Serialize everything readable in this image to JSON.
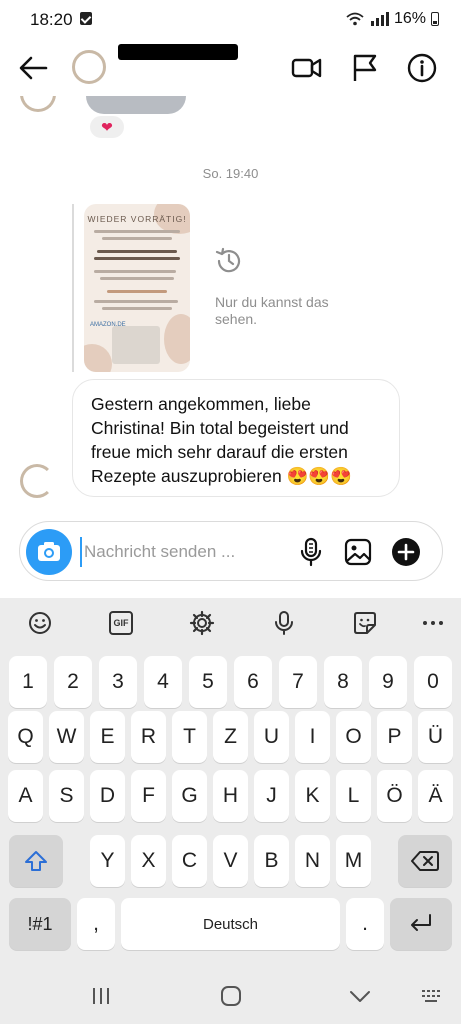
{
  "status_bar": {
    "time": "18:20",
    "battery": "16%"
  },
  "header": {
    "username": "",
    "icons": [
      "back-arrow-icon",
      "video-call-icon",
      "flag-icon",
      "info-icon"
    ]
  },
  "chat": {
    "reaction_emoji": "❤",
    "timestamp": "So. 19:40",
    "story": {
      "title": "WIEDER VORRÄTIG!",
      "badge": "AMAZON.DE",
      "note": "Nur du kannst das sehen."
    },
    "message": "Gestern angekommen, liebe Christina! Bin total begeistert und freue mich sehr darauf die ersten Rezepte auszuprobieren 😍😍😍"
  },
  "composer": {
    "placeholder": "Nachricht senden ...",
    "value": ""
  },
  "keyboard": {
    "toolbar": [
      "emoji-icon",
      "gif-icon",
      "settings-icon",
      "mic-icon",
      "sticker-icon",
      "more-icon"
    ],
    "gif_label": "GIF",
    "rows": [
      [
        "1",
        "2",
        "3",
        "4",
        "5",
        "6",
        "7",
        "8",
        "9",
        "0"
      ],
      [
        "Q",
        "W",
        "E",
        "R",
        "T",
        "Z",
        "U",
        "I",
        "O",
        "P",
        "Ü"
      ],
      [
        "A",
        "S",
        "D",
        "F",
        "G",
        "H",
        "J",
        "K",
        "L",
        "Ö",
        "Ä"
      ],
      [
        "Y",
        "X",
        "C",
        "V",
        "B",
        "N",
        "M"
      ]
    ],
    "symbols_label": "!#1",
    "comma_label": ",",
    "space_label": "Deutsch",
    "period_label": "."
  },
  "accent_color": "#2c9cf6"
}
